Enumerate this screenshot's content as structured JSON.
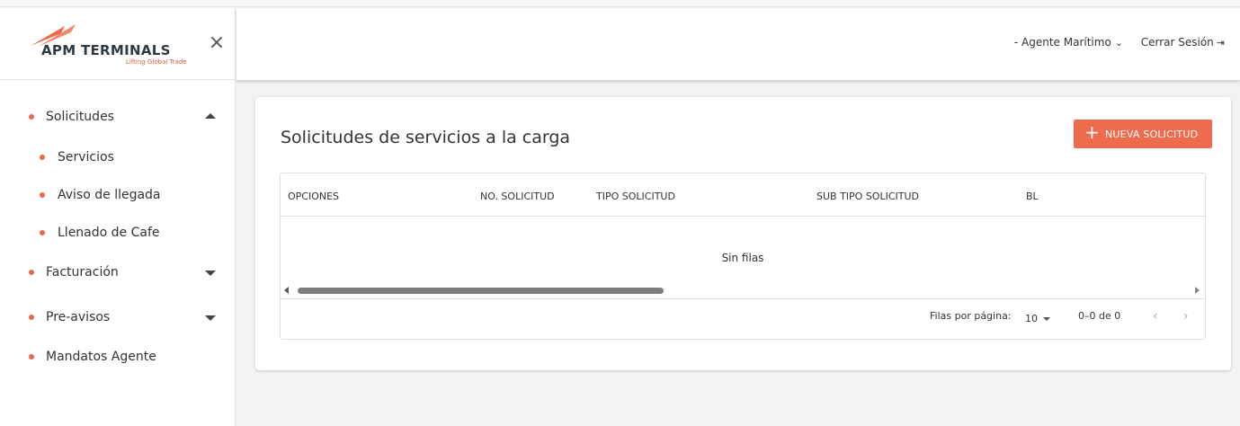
{
  "brand": {
    "name": "APM TERMINALS",
    "tagline": "Lifting Global Trade",
    "accent": "#ef6b4d",
    "close_icon": "×"
  },
  "sidebar": {
    "items": [
      {
        "label": "Solicitudes",
        "caret": "up"
      },
      {
        "label": "Servicios"
      },
      {
        "label": "Aviso de llegada"
      },
      {
        "label": "Llenado de Cafe"
      },
      {
        "label": "Facturación",
        "caret": "down"
      },
      {
        "label": "Pre-avisos",
        "caret": "down"
      },
      {
        "label": "Mandatos Agente"
      }
    ]
  },
  "header": {
    "agent_label": "- Agente Marítimo",
    "agent_chevron": "⌄",
    "logout_label": "Cerrar Sesión",
    "logout_icon": "⇥"
  },
  "main": {
    "title": "Solicitudes de servicios a la carga",
    "new_button": {
      "plus": "+",
      "label": "NUEVA SOLICITUD"
    },
    "table": {
      "columns": [
        "OPCIONES",
        "NO. SOLICITUD",
        "TIPO SOLICITUD",
        "SUB TIPO SOLICITUD",
        "BL"
      ],
      "empty_text": "Sin filas"
    },
    "pagination": {
      "rows_per_page_label": "Filas por página:",
      "rows_per_page_value": "10",
      "range": "0–0 de 0",
      "prev": "‹",
      "next": "›"
    }
  }
}
